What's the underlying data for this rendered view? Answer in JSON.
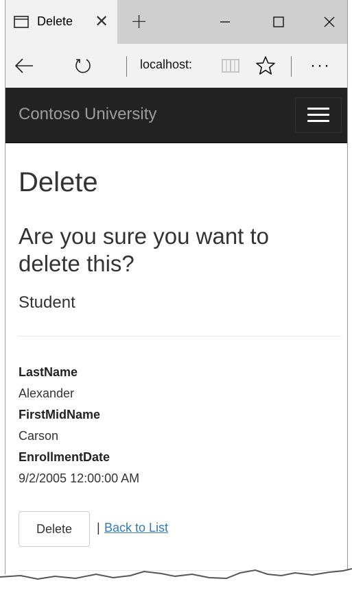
{
  "browser": {
    "tab": {
      "title": "Delete",
      "close_glyph": "✕",
      "icon": "tab-page-icon"
    },
    "new_tab_glyph": "+",
    "window_controls": [
      "minimize-icon",
      "maximize-icon",
      "close-icon"
    ],
    "address": "localhost:",
    "more_glyph": "···"
  },
  "site": {
    "brand": "Contoso University"
  },
  "page": {
    "title": "Delete",
    "question": "Are you sure you want to delete this?",
    "entity": "Student",
    "fields": [
      {
        "label": "LastName",
        "value": "Alexander"
      },
      {
        "label": "FirstMidName",
        "value": "Carson"
      },
      {
        "label": "EnrollmentDate",
        "value": "9/2/2005 12:00:00 AM"
      }
    ],
    "delete_label": "Delete",
    "separator": "|",
    "back_label": "Back to List"
  },
  "colors": {
    "header_bg": "#222222",
    "brand_text": "#9d9d9d",
    "link": "#337ab7",
    "chrome_bg": "#f2f2f2",
    "tabstrip_bg": "#cfcfcf"
  }
}
